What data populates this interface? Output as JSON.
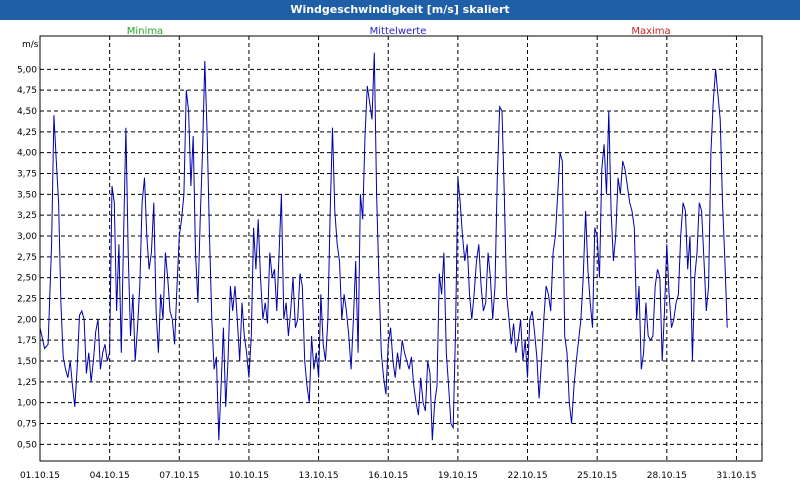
{
  "window": {
    "title": "Windgeschwindigkeit [m/s] skaliert"
  },
  "legend": [
    {
      "name": "Minima",
      "color": "#22aa22"
    },
    {
      "name": "Mittelwerte",
      "color": "#2222cc"
    },
    {
      "name": "Maxima",
      "color": "#cc2222"
    }
  ],
  "chart_data": {
    "type": "line",
    "title": "Windgeschwindigkeit [m/s] skaliert",
    "ylabel": "m/s",
    "ylim": [
      0.3,
      5.4
    ],
    "yticks": [
      "0,50",
      "0,75",
      "1,00",
      "1,25",
      "1,50",
      "1,75",
      "2,00",
      "2,25",
      "2,50",
      "2,75",
      "3,00",
      "3,25",
      "3,50",
      "3,75",
      "4,00",
      "4,25",
      "4,50",
      "4,75",
      "5,00"
    ],
    "ytick_values": [
      0.5,
      0.75,
      1.0,
      1.25,
      1.5,
      1.75,
      2.0,
      2.25,
      2.5,
      2.75,
      3.0,
      3.25,
      3.5,
      3.75,
      4.0,
      4.25,
      4.5,
      4.75,
      5.0
    ],
    "xticks": [
      "01.10.15",
      "04.10.15",
      "07.10.15",
      "10.10.15",
      "13.10.15",
      "16.10.15",
      "19.10.15",
      "22.10.15",
      "25.10.15",
      "28.10.15",
      "31.10.15"
    ],
    "xtick_days": [
      1,
      4,
      7,
      10,
      13,
      16,
      19,
      22,
      25,
      28,
      31
    ],
    "xlim_days": [
      1,
      32.1
    ],
    "grid": true,
    "line_color": "#0000aa",
    "series": [
      {
        "name": "Mittelwerte",
        "x_days": [
          1.0,
          1.2,
          1.35,
          1.5,
          1.6,
          1.7,
          1.8,
          1.9,
          2.0,
          2.1,
          2.2,
          2.3,
          2.4,
          2.5,
          2.6,
          2.7,
          2.8,
          2.9,
          3.0,
          3.1,
          3.2,
          3.3,
          3.4,
          3.5,
          3.6,
          3.7,
          3.8,
          3.9,
          4.0,
          4.1,
          4.2,
          4.3,
          4.4,
          4.5,
          4.6,
          4.7,
          4.8,
          4.9,
          5.0,
          5.1,
          5.2,
          5.3,
          5.4,
          5.5,
          5.6,
          5.7,
          5.8,
          5.9,
          6.0,
          6.1,
          6.2,
          6.3,
          6.4,
          6.5,
          6.6,
          6.7,
          6.8,
          6.9,
          7.0,
          7.1,
          7.2,
          7.3,
          7.4,
          7.5,
          7.6,
          7.7,
          7.8,
          7.9,
          8.0,
          8.1,
          8.2,
          8.3,
          8.4,
          8.5,
          8.6,
          8.7,
          8.8,
          8.9,
          9.0,
          9.1,
          9.2,
          9.3,
          9.4,
          9.5,
          9.6,
          9.7,
          9.8,
          9.9,
          10.0,
          10.1,
          10.2,
          10.3,
          10.4,
          10.5,
          10.6,
          10.7,
          10.8,
          10.9,
          11.0,
          11.1,
          11.2,
          11.3,
          11.4,
          11.5,
          11.6,
          11.7,
          11.8,
          11.9,
          12.0,
          12.1,
          12.2,
          12.3,
          12.4,
          12.5,
          12.6,
          12.7,
          12.8,
          12.9,
          13.0,
          13.1,
          13.2,
          13.3,
          13.4,
          13.5,
          13.6,
          13.7,
          13.8,
          13.9,
          14.0,
          14.1,
          14.2,
          14.3,
          14.4,
          14.5,
          14.6,
          14.7,
          14.8,
          14.9,
          15.0,
          15.1,
          15.2,
          15.3,
          15.4,
          15.5,
          15.6,
          15.7,
          15.8,
          15.9,
          16.0,
          16.1,
          16.2,
          16.3,
          16.4,
          16.5,
          16.6,
          16.7,
          16.8,
          16.9,
          17.0,
          17.1,
          17.2,
          17.3,
          17.4,
          17.5,
          17.6,
          17.7,
          17.8,
          17.9,
          18.0,
          18.1,
          18.2,
          18.3,
          18.4,
          18.5,
          18.6,
          18.7,
          18.8,
          18.9,
          19.0,
          19.1,
          19.2,
          19.3,
          19.4,
          19.5,
          19.6,
          19.7,
          19.8,
          19.9,
          20.0,
          20.1,
          20.2,
          20.3,
          20.4,
          20.5,
          20.6,
          20.7,
          20.8,
          20.9,
          21.0,
          21.1,
          21.2,
          21.3,
          21.4,
          21.5,
          21.6,
          21.7,
          21.8,
          21.9,
          22.0,
          22.1,
          22.2,
          22.3,
          22.4,
          22.5,
          22.6,
          22.7,
          22.8,
          22.9,
          23.0,
          23.1,
          23.2,
          23.3,
          23.4,
          23.5,
          23.6,
          23.7,
          23.8,
          23.9,
          24.0,
          24.1,
          24.2,
          24.3,
          24.4,
          24.5,
          24.6,
          24.7,
          24.8,
          24.9,
          25.0,
          25.1,
          25.2,
          25.3,
          25.4,
          25.5,
          25.6,
          25.7,
          25.8,
          25.9,
          26.0,
          26.1,
          26.2,
          26.3,
          26.4,
          26.5,
          26.6,
          26.7,
          26.8,
          26.9,
          27.0,
          27.1,
          27.2,
          27.3,
          27.4,
          27.5,
          27.6,
          27.7,
          27.8,
          27.9,
          28.0,
          28.1,
          28.2,
          28.3,
          28.4,
          28.5,
          28.6,
          28.7,
          28.8,
          28.9,
          29.0,
          29.1,
          29.2,
          29.3,
          29.4,
          29.5,
          29.6,
          29.7,
          29.8,
          29.9,
          30.0,
          30.1,
          30.2,
          30.3,
          30.4,
          30.5,
          30.6,
          30.7,
          30.8,
          30.9,
          31.0,
          31.1,
          31.2,
          31.3,
          31.4,
          31.5,
          31.6,
          31.7,
          31.8,
          31.9,
          32.0,
          32.1
        ],
        "values": [
          1.9,
          1.65,
          1.7,
          2.9,
          4.45,
          3.9,
          3.4,
          2.2,
          1.55,
          1.4,
          1.3,
          1.5,
          1.2,
          0.95,
          1.4,
          2.05,
          2.1,
          2.0,
          1.35,
          1.6,
          1.25,
          1.5,
          1.85,
          2.0,
          1.4,
          1.6,
          1.7,
          1.5,
          1.6,
          3.6,
          3.4,
          2.1,
          2.9,
          1.6,
          3.0,
          4.3,
          2.8,
          1.8,
          2.3,
          1.5,
          1.9,
          2.4,
          3.4,
          3.7,
          3.0,
          2.6,
          2.8,
          3.4,
          2.1,
          1.6,
          2.3,
          2.0,
          2.8,
          2.5,
          2.1,
          2.0,
          1.7,
          2.4,
          3.0,
          3.2,
          3.5,
          4.75,
          4.5,
          3.6,
          4.2,
          2.8,
          2.2,
          3.2,
          4.0,
          5.1,
          4.2,
          3.0,
          2.0,
          1.4,
          1.55,
          0.55,
          1.2,
          1.9,
          0.95,
          1.5,
          2.4,
          2.1,
          2.4,
          2.0,
          1.5,
          2.2,
          1.8,
          1.6,
          1.3,
          1.8,
          3.1,
          2.6,
          3.2,
          2.5,
          2.0,
          2.2,
          1.95,
          2.8,
          2.5,
          2.6,
          2.1,
          2.8,
          3.5,
          2.0,
          2.2,
          1.8,
          2.1,
          2.5,
          1.9,
          2.0,
          2.55,
          2.4,
          1.5,
          1.2,
          1.0,
          1.8,
          1.4,
          1.6,
          1.3,
          2.3,
          1.7,
          1.5,
          2.0,
          3.3,
          4.3,
          3.3,
          2.9,
          2.7,
          2.0,
          2.3,
          2.1,
          1.8,
          1.4,
          2.0,
          2.7,
          1.6,
          3.5,
          3.2,
          4.2,
          4.8,
          4.6,
          4.4,
          5.2,
          3.5,
          2.5,
          1.6,
          1.3,
          1.1,
          1.7,
          1.9,
          1.5,
          1.3,
          1.6,
          1.4,
          1.75,
          1.6,
          1.5,
          1.4,
          1.55,
          1.2,
          1.0,
          0.85,
          1.3,
          1.0,
          0.9,
          1.5,
          1.35,
          0.55,
          1.0,
          1.2,
          2.55,
          2.3,
          2.8,
          1.6,
          1.2,
          0.75,
          0.7,
          1.9,
          3.7,
          3.4,
          3.0,
          2.7,
          2.9,
          2.3,
          2.0,
          2.3,
          2.7,
          2.9,
          2.4,
          2.1,
          2.2,
          2.8,
          2.5,
          2.0,
          2.4,
          3.7,
          4.55,
          4.5,
          3.5,
          2.3,
          2.0,
          1.7,
          1.95,
          1.6,
          1.75,
          2.0,
          1.5,
          1.75,
          1.3,
          2.0,
          2.1,
          1.85,
          1.55,
          1.05,
          1.5,
          2.0,
          2.4,
          2.3,
          2.1,
          2.8,
          3.0,
          3.5,
          4.0,
          3.9,
          1.8,
          1.6,
          1.0,
          0.75,
          1.2,
          1.5,
          1.75,
          2.0,
          2.5,
          3.3,
          2.6,
          2.2,
          1.9,
          3.1,
          3.0,
          2.5,
          3.8,
          4.1,
          3.5,
          4.5,
          3.3,
          2.7,
          3.0,
          3.7,
          3.5,
          3.9,
          3.8,
          3.6,
          3.4,
          3.3,
          3.1,
          2.0,
          2.4,
          1.4,
          1.6,
          2.2,
          1.8,
          1.75,
          1.8,
          2.4,
          2.6,
          2.5,
          1.5,
          2.1,
          2.9,
          2.3,
          1.9,
          2.0,
          2.2,
          2.3,
          3.0,
          3.4,
          3.3,
          2.6,
          3.0,
          1.5,
          2.5,
          2.8,
          3.4,
          3.3,
          2.7,
          2.1,
          2.4,
          4.0,
          4.6,
          5.0,
          4.7,
          4.4,
          3.4,
          2.7,
          1.9
        ]
      }
    ]
  }
}
